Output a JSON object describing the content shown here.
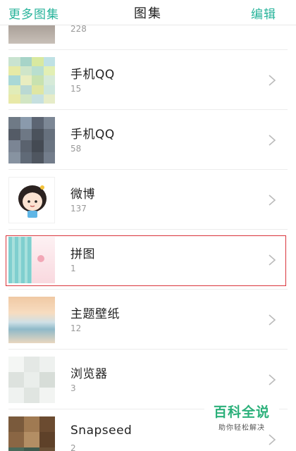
{
  "header": {
    "left_label": "更多图集",
    "title": "图集",
    "right_label": "编辑"
  },
  "albums": [
    {
      "name": "",
      "count": "228",
      "thumb": "partial-photo"
    },
    {
      "name": "手机QQ",
      "count": "15",
      "thumb": "blurred-mosaic-light"
    },
    {
      "name": "手机QQ",
      "count": "58",
      "thumb": "blurred-mosaic-dark"
    },
    {
      "name": "微博",
      "count": "137",
      "thumb": "cartoon-girl"
    },
    {
      "name": "拼图",
      "count": "1",
      "thumb": "collage-teal-pink",
      "highlighted": true
    },
    {
      "name": "主题壁纸",
      "count": "12",
      "thumb": "sunset-beach"
    },
    {
      "name": "浏览器",
      "count": "3",
      "thumb": "blurred-mosaic-white"
    },
    {
      "name": "Snapseed",
      "count": "2",
      "thumb": "blurred-mosaic-brown"
    }
  ],
  "watermark": {
    "title": "百科全说",
    "subtitle": "助你轻松解决"
  },
  "colors": {
    "accent": "#27b39a",
    "highlight_border": "#d9343b",
    "watermark_green": "#2bb07a"
  }
}
